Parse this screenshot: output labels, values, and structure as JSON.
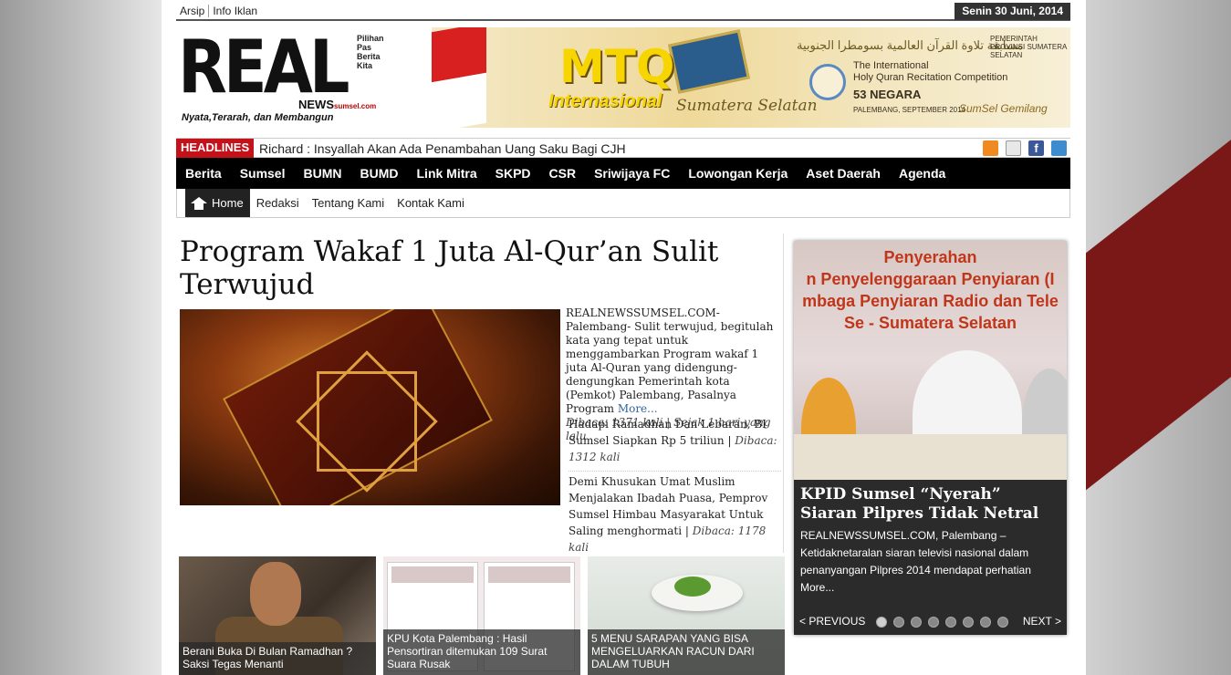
{
  "top": {
    "links": [
      "Arsip",
      "Info Iklan"
    ],
    "date": "Senin 30 Juni, 2014"
  },
  "logo": {
    "big": "REAL",
    "side_lines": [
      "Pilihan",
      "Pas",
      "Berita",
      "Kita"
    ],
    "news": "NEWS",
    "domain": "sumsel.com",
    "tagline": "Nyata,Terarah, dan Membangun"
  },
  "banner": {
    "mtq": "MTQ",
    "sub": "Internasional",
    "sub2": "Sumatera Selatan",
    "arabic": "مسابقة تلاوة القرآن العالمية بسومطرا الجنوبية",
    "int_line1": "The International",
    "int_line2": "Holy Quran Recitation Competition",
    "negara": "53 NEGARA",
    "palembang": "PALEMBANG, SEPTEMBER 2014",
    "prov": "PEMERINTAH PROVINSI SUMATERA SELATAN",
    "gemilang": "SumSel Gemilang"
  },
  "headlines": {
    "label": "HEADLINES",
    "text": "Richard : Insyallah Akan Ada Penambahan Uang Saku Bagi CJH"
  },
  "social_icons": [
    "rss-icon",
    "mail-icon",
    "facebook-icon",
    "twitter-icon"
  ],
  "main_nav": [
    "Berita",
    "Sumsel",
    "BUMN",
    "BUMD",
    "Link Mitra",
    "SKPD",
    "CSR",
    "Sriwijaya FC",
    "Lowongan Kerja",
    "Aset Daerah",
    "Agenda"
  ],
  "sub_nav": {
    "home": "Home",
    "links": [
      "Redaksi",
      "Tentang Kami",
      "Kontak Kami"
    ]
  },
  "article": {
    "title": "Program Wakaf 1 Juta Al-Qur’an Sulit Terwujud",
    "excerpt": " REALNEWSSUMSEL.COM- Palembang- Sulit terwujud, begitulah kata yang tepat untuk menggambarkan Program wakaf 1 juta Al-Quran yang didengung-dengungkan Pemerintah kota (Pemkot) Palembang, Pasalnya Program ",
    "more": "More...",
    "meta": "Dibaca: 1371 kali | Sejak 1 hari yang lalu"
  },
  "related": [
    {
      "title": "Hadapi Ramadhan Dan Lebaran, BI Sumsel Siapkan Rp 5 triliun",
      "sep": " | ",
      "meta": "Dibaca: 1312 kali"
    },
    {
      "title": "Demi Khusukan Umat Muslim Menjalakan Ibadah Puasa, Pemprov Sumsel Himbau Masyarakat Untuk Saling menghormati",
      "sep": " | ",
      "meta": "Dibaca: 1178 kali"
    }
  ],
  "thumbs": [
    {
      "caption": "Berani Buka Di Bulan Ramadhan ? Saksi Tegas Menanti"
    },
    {
      "caption": "KPU Kota Palembang : Hasil Pensortiran ditemukan 109 Surat Suara Rusak"
    },
    {
      "caption": "5 MENU SARAPAN YANG BISA MENGELUARKAN RACUN DARI DALAM TUBUH"
    }
  ],
  "slider": {
    "banner_lines": [
      "Penyerahan",
      "n Penyelenggaraan Penyiaran (I",
      "mbaga Penyiaran Radio dan Tele",
      "Se - Sumatera Selatan"
    ],
    "title": "KPID Sumsel “Nyerah” Siaran Pilpres Tidak Netral",
    "text": " REALNEWSSUMSEL.COM, Palembang – Ketidaknetaralan siaran televisi nasional dalam penanyangan Pilpres 2014 mendapat perhatian More...",
    "prev": "< PREVIOUS",
    "next": "NEXT >",
    "dot_count": 8,
    "active_dot": 1
  },
  "colors": {
    "headline_red": "#c4121a",
    "nav_black": "#000000",
    "link_blue": "#336699"
  }
}
